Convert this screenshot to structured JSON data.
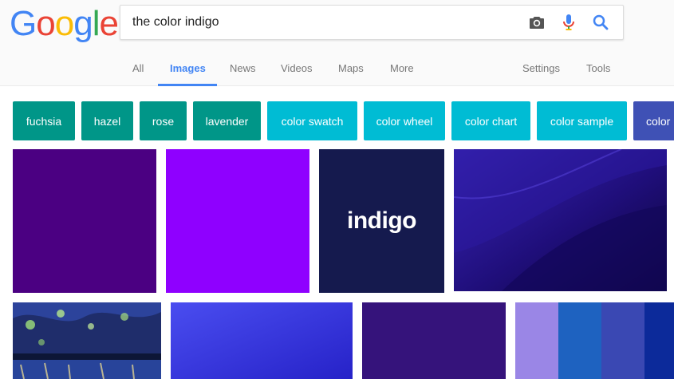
{
  "logo": {
    "letters": [
      {
        "char": "G",
        "color": "#4285F4"
      },
      {
        "char": "o",
        "color": "#EA4335"
      },
      {
        "char": "o",
        "color": "#FBBC05"
      },
      {
        "char": "g",
        "color": "#4285F4"
      },
      {
        "char": "l",
        "color": "#34A853"
      },
      {
        "char": "e",
        "color": "#EA4335"
      }
    ]
  },
  "search": {
    "query": "the color indigo",
    "icons": [
      "camera-icon",
      "microphone-icon",
      "search-icon"
    ]
  },
  "nav": {
    "all": "All",
    "images": "Images",
    "news": "News",
    "videos": "Videos",
    "maps": "Maps",
    "more": "More",
    "settings": "Settings",
    "tools": "Tools",
    "active": "Images"
  },
  "chips": [
    {
      "label": "fuchsia",
      "color": "#009688"
    },
    {
      "label": "hazel",
      "color": "#009688"
    },
    {
      "label": "rose",
      "color": "#009688"
    },
    {
      "label": "lavender",
      "color": "#009688"
    },
    {
      "label": "color swatch",
      "color": "#00BCD4"
    },
    {
      "label": "color wheel",
      "color": "#00BCD4"
    },
    {
      "label": "color chart",
      "color": "#00BCD4"
    },
    {
      "label": "color sample",
      "color": "#00BCD4"
    },
    {
      "label": "color",
      "color": "#3F51B5"
    }
  ],
  "results": {
    "tile3_text": "indigo",
    "colors": {
      "tile1": "#4b0082",
      "tile2": "#8f00ff",
      "tile3": "#151a4e",
      "tile4": "#1b0d6e",
      "tile6": "#3535dc",
      "tile7": "#35137b"
    },
    "stripes": [
      "#9a86e6",
      "#1e62c0",
      "#3a48b3",
      "#0c2a9a"
    ]
  }
}
